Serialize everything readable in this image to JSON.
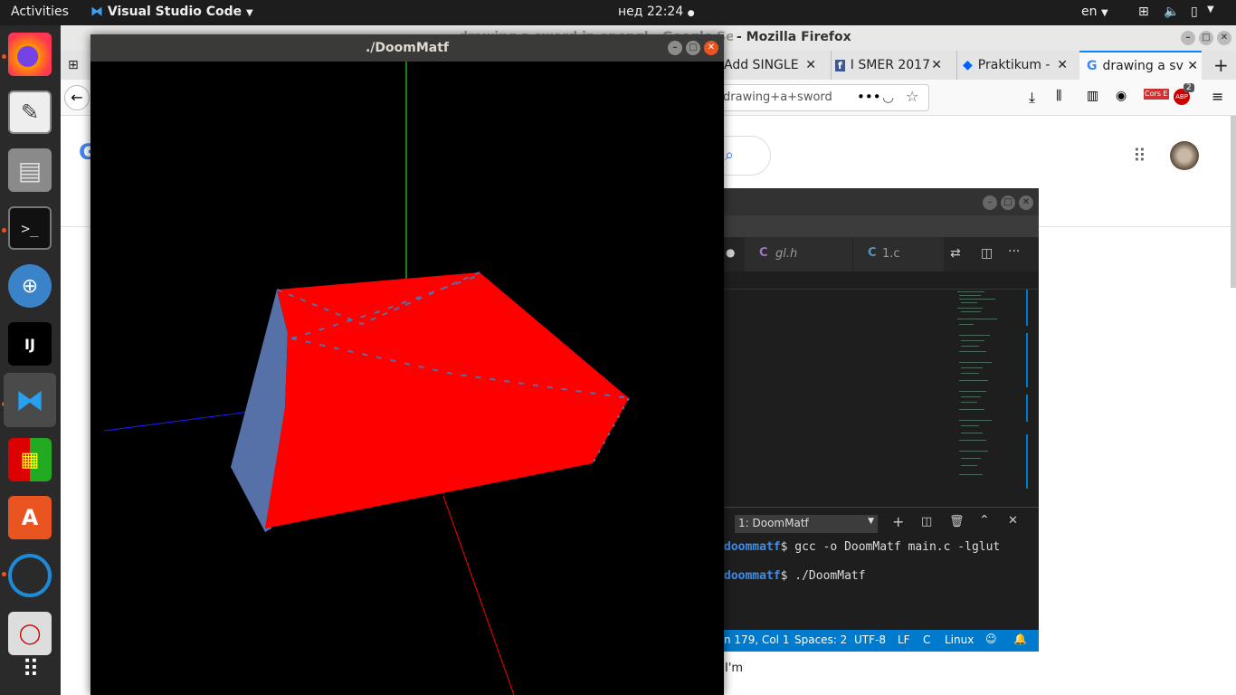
{
  "topbar": {
    "activities": "Activities",
    "app_menu": "Visual Studio Code",
    "clock": "нед 22:24",
    "lang": "en"
  },
  "firefox": {
    "window_title": "- Mozilla Firefox",
    "window_title_partial": "drawing a sword in opengl - Google Search",
    "tabs": [
      {
        "label": "Add SINGLE",
        "icon": "generic-page-icon"
      },
      {
        "label": "I SMER 2017",
        "icon": "facebook-icon"
      },
      {
        "label": "Praktikum -",
        "icon": "dropbox-icon"
      },
      {
        "label": "drawing a sv",
        "icon": "google-icon"
      }
    ],
    "url_partial": "drawing+a+sword",
    "ext_badge": "2",
    "cors_label": "Cors E",
    "abp_label": "ABP",
    "page_snippet": "I'm"
  },
  "vscode": {
    "tabs": [
      {
        "label": "gl.h",
        "lang": "C"
      },
      {
        "label": "1.c",
        "lang": "C"
      }
    ],
    "terminal_selector": "1: DoomMatf",
    "terminal_lines": [
      {
        "prompt": "doommatf",
        "cmd": "$ gcc -o DoomMatf  main.c -lglut"
      },
      {
        "prompt": "doommatf",
        "cmd": "$ ./DoomMatf"
      }
    ],
    "status": {
      "position": "n 179, Col 1",
      "spaces": "Spaces: 2",
      "encoding": "UTF-8",
      "eol": "LF",
      "language": "C",
      "platform": "Linux"
    }
  },
  "doom_window": {
    "title": "./DoomMatf"
  },
  "colors": {
    "ubuntu_orange": "#e95420",
    "vscode_blue": "#007acc",
    "box_red": "#ff0000",
    "box_side": "#5670a8"
  }
}
